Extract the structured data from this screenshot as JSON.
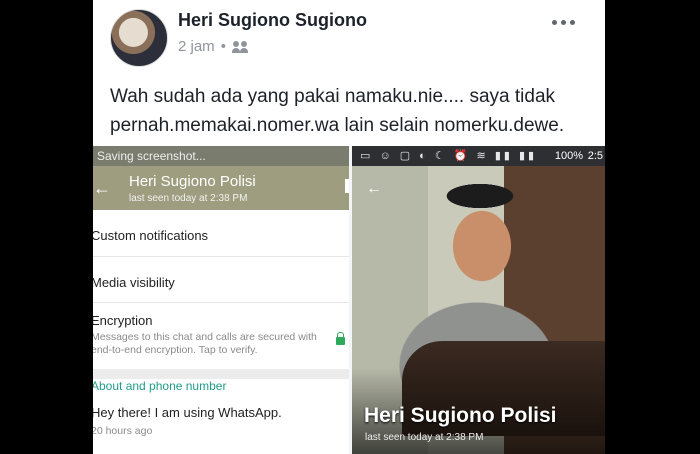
{
  "post": {
    "author": "Heri Sugiono Sugiono",
    "time": "2 jam",
    "text": "Wah sudah ada yang pakai namaku.nie.... saya tidak pernah.memakai.nomer.wa lain selain nomerku.dewe."
  },
  "left_screenshot": {
    "status_text": "Saving screenshot...",
    "contact_name": "Heri Sugiono Polisi",
    "last_seen": "last seen today at 2:38 PM",
    "items": [
      {
        "label": "Custom notifications"
      },
      {
        "label": "Media visibility"
      },
      {
        "label": "Encryption",
        "desc": "Messages to this chat and calls are secured with end-to-end encryption. Tap to verify."
      }
    ],
    "about_title": "About and phone number",
    "about_text": "Hey there! I am using WhatsApp.",
    "about_time": "20 hours ago"
  },
  "right_screenshot": {
    "battery": "100%",
    "time": "2:5",
    "contact_name": "Heri Sugiono Polisi",
    "last_seen": "last seen today at 2:38 PM"
  }
}
